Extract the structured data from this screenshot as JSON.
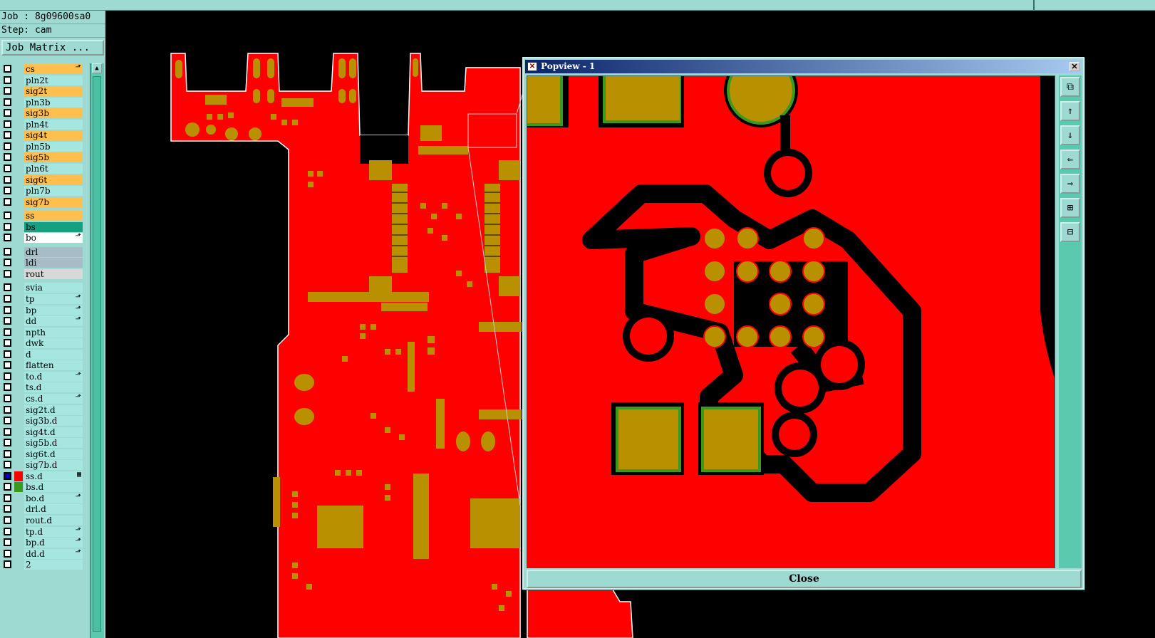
{
  "job": {
    "label": "Job : 8g09600sa0",
    "step": "Step: cam"
  },
  "job_matrix_label": "Job Matrix ...",
  "popview": {
    "title": "Popview - 1",
    "close_label": "Close",
    "title_icon": "✕",
    "close_x": "✕"
  },
  "tools": [
    "zoom-fit-icon",
    "pan-up-icon",
    "pan-down-icon",
    "pan-left-icon",
    "pan-right-icon",
    "zoom-in-icon",
    "zoom-out-icon"
  ],
  "colors": {
    "copper": "#ff0000",
    "pad": "#b89000",
    "panel": "#9fdad2",
    "signal_layer": "#ffbf4f",
    "plane_layer": "#a6e6e0",
    "mask_layer": "#22a07a"
  },
  "layers": [
    {
      "name": "cs",
      "bg": "#ffbf4f",
      "flag": "⬏"
    },
    {
      "name": "pln2t",
      "bg": "#a6e6e0"
    },
    {
      "name": "sig2t",
      "bg": "#ffbf4f"
    },
    {
      "name": "pln3b",
      "bg": "#a6e6e0"
    },
    {
      "name": "sig3b",
      "bg": "#ffbf4f"
    },
    {
      "name": "pln4t",
      "bg": "#a6e6e0"
    },
    {
      "name": "sig4t",
      "bg": "#ffbf4f"
    },
    {
      "name": "pln5b",
      "bg": "#a6e6e0"
    },
    {
      "name": "sig5b",
      "bg": "#ffbf4f"
    },
    {
      "name": "pln6t",
      "bg": "#a6e6e0"
    },
    {
      "name": "sig6t",
      "bg": "#ffbf4f"
    },
    {
      "name": "pln7b",
      "bg": "#a6e6e0"
    },
    {
      "name": "sig7b",
      "bg": "#ffbf4f"
    },
    {
      "name": "ss",
      "bg": "#ffbf4f"
    },
    {
      "name": "bs",
      "bg": "#16a082"
    },
    {
      "name": "bo",
      "bg": "#ffffff",
      "flag": "⬏"
    },
    {
      "name": "drl",
      "bg": "#a7bcc6"
    },
    {
      "name": "ldi",
      "bg": "#a7bcc6"
    },
    {
      "name": "rout",
      "bg": "#d8d8d8"
    },
    {
      "name": "svia",
      "bg": "#a6e6e0"
    },
    {
      "name": "tp",
      "bg": "#a6e6e0",
      "flag": "⬏"
    },
    {
      "name": "bp",
      "bg": "#a6e6e0",
      "flag": "⬏"
    },
    {
      "name": "dd",
      "bg": "#a6e6e0",
      "flag": "⬏"
    },
    {
      "name": "npth",
      "bg": "#a6e6e0"
    },
    {
      "name": "dwk",
      "bg": "#a6e6e0"
    },
    {
      "name": "d",
      "bg": "#a6e6e0"
    },
    {
      "name": "flatten",
      "bg": "#a6e6e0"
    },
    {
      "name": "to.d",
      "bg": "#a6e6e0",
      "flag": "⬏"
    },
    {
      "name": "ts.d",
      "bg": "#a6e6e0"
    },
    {
      "name": "cs.d",
      "bg": "#a6e6e0",
      "flag": "⬏"
    },
    {
      "name": "sig2t.d",
      "bg": "#a6e6e0"
    },
    {
      "name": "sig3b.d",
      "bg": "#a6e6e0"
    },
    {
      "name": "sig4t.d",
      "bg": "#a6e6e0"
    },
    {
      "name": "sig5b.d",
      "bg": "#a6e6e0"
    },
    {
      "name": "sig6t.d",
      "bg": "#a6e6e0"
    },
    {
      "name": "sig7b.d",
      "bg": "#a6e6e0"
    },
    {
      "name": "ss.d",
      "bg": "#a6e6e0",
      "color": "#ff0000",
      "flag": "▦",
      "checked": true
    },
    {
      "name": "bs.d",
      "bg": "#a6e6e0",
      "color": "#3a9a20"
    },
    {
      "name": "bo.d",
      "bg": "#a6e6e0",
      "flag": "⬏"
    },
    {
      "name": "drl.d",
      "bg": "#a6e6e0"
    },
    {
      "name": "rout.d",
      "bg": "#a6e6e0"
    },
    {
      "name": "tp.d",
      "bg": "#a6e6e0",
      "flag": "⬏"
    },
    {
      "name": "bp.d",
      "bg": "#a6e6e0",
      "flag": "⬏"
    },
    {
      "name": "dd.d",
      "bg": "#a6e6e0",
      "flag": "⬏"
    },
    {
      "name": "2",
      "bg": "#a6e6e0"
    }
  ]
}
